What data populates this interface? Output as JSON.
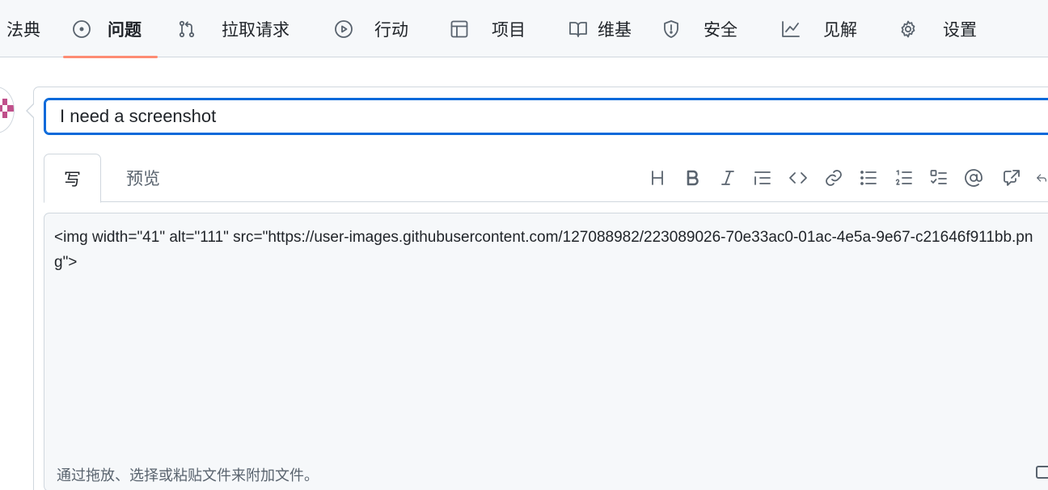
{
  "nav": {
    "items": [
      {
        "label": "法典",
        "icon": "code-icon"
      },
      {
        "label": "问题",
        "icon": "issue-opened-icon",
        "active": true
      },
      {
        "label": "拉取请求",
        "icon": "git-pull-request-icon"
      },
      {
        "label": "行动",
        "icon": "play-icon"
      },
      {
        "label": "项目",
        "icon": "table-icon"
      },
      {
        "label": "维基",
        "icon": "book-icon"
      },
      {
        "label": "安全",
        "icon": "shield-icon"
      },
      {
        "label": "见解",
        "icon": "graph-icon"
      },
      {
        "label": "设置",
        "icon": "gear-icon"
      }
    ]
  },
  "issue_form": {
    "title_value": "I need a screenshot",
    "tabs": {
      "write": "写",
      "preview": "预览"
    },
    "toolbar": [
      "heading-icon",
      "bold-icon",
      "italic-icon",
      "quote-icon",
      "code-icon",
      "link-icon",
      "bulleted-list-icon",
      "numbered-list-icon",
      "task-list-icon",
      "mention-icon",
      "cross-reference-icon",
      "reply-icon"
    ],
    "body_value": "<img width=\"41\" alt=\"111\" src=\"https://user-images.githubusercontent.com/127088982/223089026-70e33ac0-01ac-4e5a-9e67-c21646f911bb.png\">",
    "attach_hint": "通过拖放、选择或粘贴文件来附加文件。"
  },
  "colors": {
    "accent": "#0969da",
    "nav_underline": "#fd8c73",
    "avatar": "#c0508b"
  }
}
